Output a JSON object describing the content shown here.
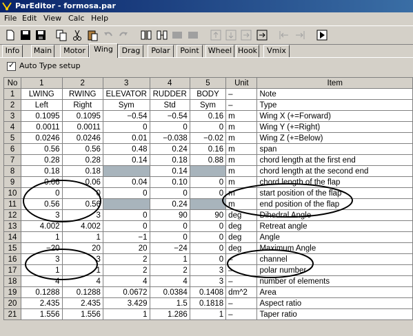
{
  "window": {
    "title": "ParEditor - formosa.par"
  },
  "menu": [
    "File",
    "Edit",
    "View",
    "Calc",
    "Help"
  ],
  "toolbar": [
    "new-icon",
    "save-icon",
    "save-all-icon",
    "copy-icon",
    "cut-icon",
    "paste-icon",
    "undo-icon",
    "redo-icon",
    "insert-col-icon",
    "delete-col-icon",
    "col-left-icon",
    "col-right-icon",
    "row-up-icon",
    "row-down-icon",
    "row-insert-icon",
    "row-delete-icon",
    "move-left-icon",
    "move-right-icon",
    "run-icon"
  ],
  "tabs": [
    "Info",
    "Main",
    "Motor",
    "Wing",
    "Drag",
    "Polar",
    "Point",
    "Wheel",
    "Hook",
    "Vmix"
  ],
  "active_tab": "Wing",
  "auto_type": {
    "label": "Auto Type setup",
    "checked": true
  },
  "table": {
    "headers": [
      "No",
      "1",
      "2",
      "3",
      "4",
      "5",
      "Unit",
      "Item"
    ],
    "rows": [
      [
        "1",
        "LWING",
        "RWING",
        "ELEVATOR",
        "RUDDER",
        "BODY",
        "–",
        "Note"
      ],
      [
        "2",
        "Left",
        "Right",
        "Sym",
        "Std",
        "Sym",
        "–",
        "Type"
      ],
      [
        "3",
        "0.1095",
        "0.1095",
        "−0.54",
        "−0.54",
        "0.16",
        "m",
        "Wing X (+=Forward)"
      ],
      [
        "4",
        "0.0011",
        "0.0011",
        "0",
        "0",
        "0",
        "m",
        "Wing Y (+=Right)"
      ],
      [
        "5",
        "0.0246",
        "0.0246",
        "0.01",
        "−0.038",
        "−0.02",
        "m",
        "Wing Z (+=Below)"
      ],
      [
        "6",
        "0.56",
        "0.56",
        "0.48",
        "0.24",
        "0.16",
        "m",
        "span"
      ],
      [
        "7",
        "0.28",
        "0.28",
        "0.14",
        "0.18",
        "0.88",
        "m",
        "chord length at the first end"
      ],
      [
        "8",
        "0.18",
        "0.18",
        "",
        "0.14",
        "",
        "m",
        "chord length at the second end"
      ],
      [
        "9",
        "0.06",
        "0.06",
        "0.04",
        "0.10",
        "0",
        "m",
        "chord length of the flap"
      ],
      [
        "10",
        "0",
        "0",
        "0",
        "0",
        "0",
        "m",
        "start position of the flap"
      ],
      [
        "11",
        "0.56",
        "0.56",
        "",
        "0.24",
        "",
        "m",
        "end position of the flap"
      ],
      [
        "12",
        "3",
        "3",
        "0",
        "90",
        "90",
        "deg",
        "Dihedral Angle"
      ],
      [
        "13",
        "4.002",
        "4.002",
        "0",
        "0",
        "0",
        "deg",
        "Retreat angle"
      ],
      [
        "14",
        "1",
        "1",
        "−1",
        "0",
        "0",
        "deg",
        "Angle"
      ],
      [
        "15",
        "−20",
        "20",
        "20",
        "−24",
        "0",
        "deg",
        "Maximum Angle"
      ],
      [
        "16",
        "3",
        "3",
        "2",
        "1",
        "0",
        "–",
        "channel"
      ],
      [
        "17",
        "1",
        "1",
        "2",
        "2",
        "3",
        "–",
        "polar number"
      ],
      [
        "18",
        "4",
        "4",
        "4",
        "4",
        "3",
        "–",
        "number of elements"
      ],
      [
        "19",
        "0.1288",
        "0.1288",
        "0.0672",
        "0.0384",
        "0.1408",
        "dm^2",
        "Area"
      ],
      [
        "20",
        "2.435",
        "2.435",
        "3.429",
        "1.5",
        "0.1818",
        "–",
        "Aspect ratio"
      ],
      [
        "21",
        "1.556",
        "1.556",
        "1",
        "1.286",
        "1",
        "–",
        "Taper ratio"
      ]
    ],
    "gray_cells": [
      [
        7,
        3
      ],
      [
        7,
        5
      ],
      [
        10,
        3
      ],
      [
        10,
        5
      ]
    ]
  },
  "colors": {
    "title_bar": "#0a246a",
    "window_bg": "#d4d0c8",
    "gray_cell": "#a8b4bc"
  }
}
